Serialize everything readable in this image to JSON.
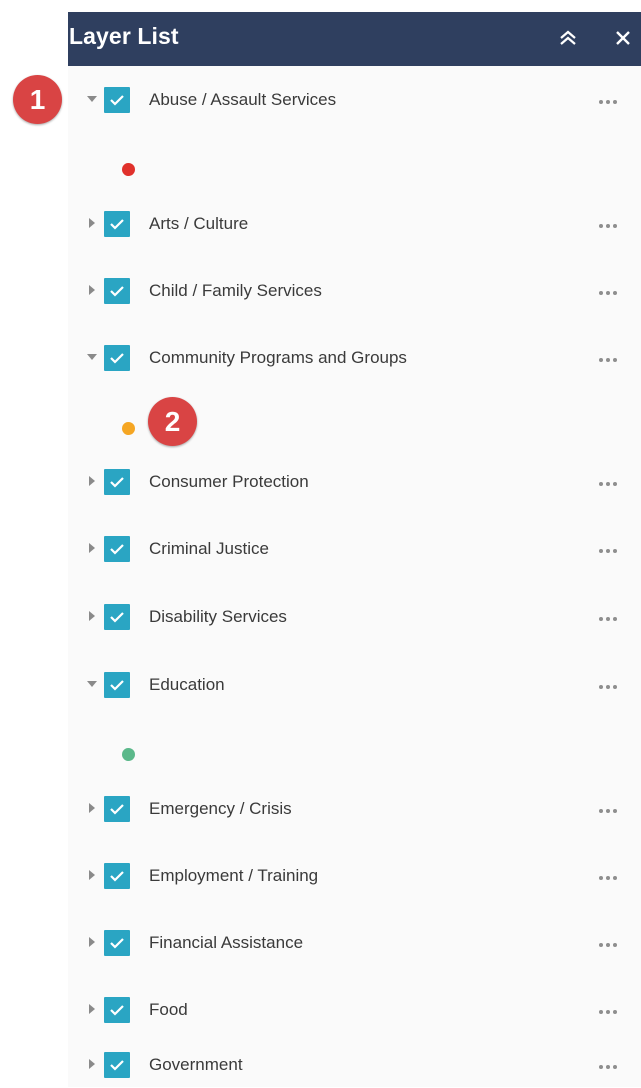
{
  "panel": {
    "title": "Layer List",
    "collapse_icon": "double-chevron-up-icon",
    "close_icon": "close-icon",
    "header_color": "#2f3f5f"
  },
  "colors": {
    "checkbox": "#2aa5c3",
    "badge": "#d94444"
  },
  "layers": [
    {
      "label": "Abuse / Assault Services",
      "checked": true,
      "expanded": true,
      "legend_color": "#e0312b"
    },
    {
      "label": "Arts / Culture",
      "checked": true,
      "expanded": false
    },
    {
      "label": "Child / Family Services",
      "checked": true,
      "expanded": false
    },
    {
      "label": "Community Programs and Groups",
      "checked": true,
      "expanded": true,
      "legend_color": "#f5a623"
    },
    {
      "label": "Consumer Protection",
      "checked": true,
      "expanded": false
    },
    {
      "label": "Criminal Justice",
      "checked": true,
      "expanded": false
    },
    {
      "label": "Disability Services",
      "checked": true,
      "expanded": false
    },
    {
      "label": "Education",
      "checked": true,
      "expanded": true,
      "legend_color": "#5bb88a"
    },
    {
      "label": "Emergency / Crisis",
      "checked": true,
      "expanded": false
    },
    {
      "label": "Employment / Training",
      "checked": true,
      "expanded": false
    },
    {
      "label": "Financial Assistance",
      "checked": true,
      "expanded": false
    },
    {
      "label": "Food",
      "checked": true,
      "expanded": false
    },
    {
      "label": "Government",
      "checked": true,
      "expanded": false
    }
  ],
  "annotations": [
    {
      "number": "1"
    },
    {
      "number": "2"
    }
  ]
}
